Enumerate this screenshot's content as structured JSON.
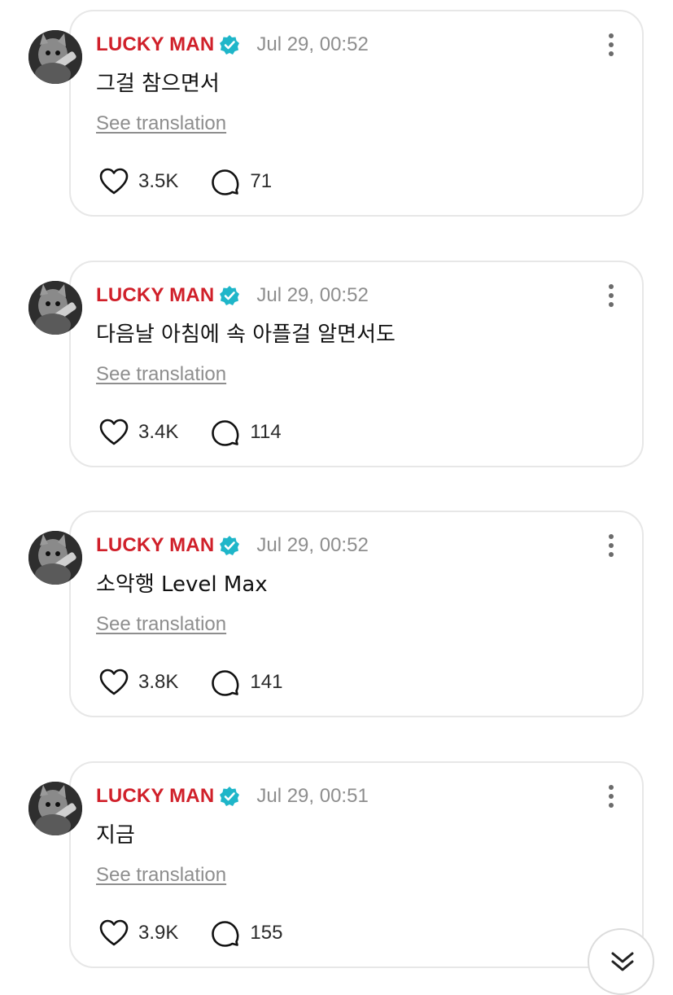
{
  "posts": [
    {
      "username": "LUCKY MAN",
      "timestamp": "Jul 29, 00:52",
      "text": "그걸 참으면서",
      "translate_label": "See translation",
      "likes": "3.5K",
      "comments": "71"
    },
    {
      "username": "LUCKY MAN",
      "timestamp": "Jul 29, 00:52",
      "text": "다음날 아침에 속 아플걸 알면서도",
      "translate_label": "See translation",
      "likes": "3.4K",
      "comments": "114"
    },
    {
      "username": "LUCKY MAN",
      "timestamp": "Jul 29, 00:52",
      "text": "소악행 Level Max",
      "translate_label": "See translation",
      "likes": "3.8K",
      "comments": "141"
    },
    {
      "username": "LUCKY MAN",
      "timestamp": "Jul 29, 00:51",
      "text": "지금",
      "translate_label": "See translation",
      "likes": "3.9K",
      "comments": "155"
    }
  ],
  "icons": {
    "verified": "verified-badge-icon",
    "more": "more-vertical-icon",
    "like": "heart-icon",
    "comment": "comment-bubble-icon",
    "scroll": "double-chevron-down-icon"
  },
  "colors": {
    "username": "#d0202a",
    "verified": "#1fb6c9",
    "muted": "#8e8e8e",
    "card_border": "#e7e7e7"
  }
}
